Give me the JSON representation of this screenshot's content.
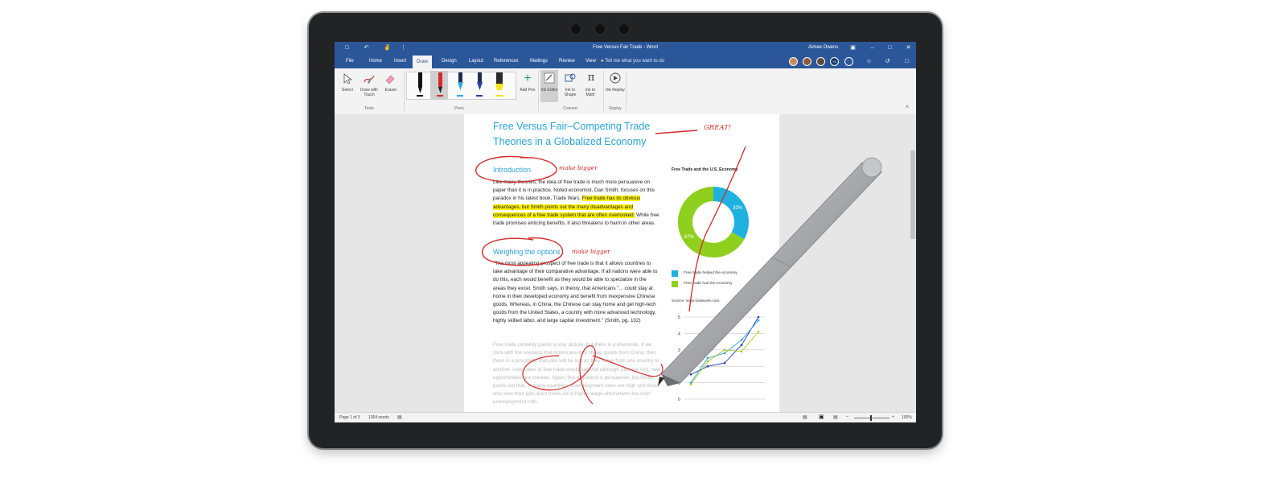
{
  "window": {
    "title": "Free Versus Fair Trade - Word",
    "user": "Aimee Owens"
  },
  "tabs": [
    "File",
    "Home",
    "Insert",
    "Draw",
    "Design",
    "Layout",
    "References",
    "Mailings",
    "Review",
    "View"
  ],
  "tell_me": "Tell me what you want to do",
  "ribbon": {
    "tools": {
      "select": "Select",
      "draw_with_touch": "Draw with Touch",
      "eraser": "Eraser",
      "group": "Tools"
    },
    "pens": {
      "group": "Pens",
      "add_pen": "Add Pen"
    },
    "convert": {
      "ink_editor": "Ink Editor",
      "ink_to_shape": "Ink to Shape",
      "ink_to_math": "Ink to Math",
      "group": "Convert"
    },
    "replay": {
      "ink_replay": "Ink Replay",
      "group": "Replay"
    }
  },
  "document": {
    "title": "Free Versus Fair–Competing Trade Theories in a Globalized Economy",
    "intro_heading": "Introduction",
    "intro_before": "Like many theories, the idea of free trade is much more persuasive on paper than it is in practice. Noted economist, Dan Smith, focuses on this paradox in his latest book, Trade Wars. ",
    "intro_highlight": "Free trade has its obvious advantages, but Smith points out the many disadvantages and consequences of a free trade system that are often overlooked.",
    "intro_after": " While free trade promises enticing benefits, it also threatens to harm in other areas.",
    "options_heading": "Weighing the options",
    "options_para": "\"The most appealing prospect of free trade is that it allows countries to take advantage of their comparative advantage. If all nations were able to do this, each would benefit as they would be able to specialize in the areas they excel. Smith says, in theory, that Americans \"... could stay at home in their developed economy and benefit from inexpensive Chinese goods. Whereas, in China, the Chinese can stay home and get high-tech goods from the United States, a country with more advanced technology, highly skilled labor, and large capital investment.\" (Smith, pg. 102)",
    "faded_para": "Free trade certainly paints a rosy picture, but there is a downside. If we stick with the scenario that Americans buy cheap goods from China, then there is a possibility that jobs will be lost as they move from one country to another. Advocates of free trade would say that although jobs are lost, new opportunities are created. Again, this argument is persuasive, but Smith points out that, in many countries, unemployment rates are high and those who lose their jobs don't move on to higher-wage alternatives but onto unemployment rolls."
  },
  "annotations": {
    "great": "GREAT!",
    "make_bigger_1": "make bigger",
    "make_bigger_2": "make bigger"
  },
  "sidebar_chart": {
    "title": "Free Trade and the U.S. Economy",
    "legend": [
      "Free trade helped the economy",
      "Free trade hurt the economy"
    ],
    "source": "Source: www.tradewire.com",
    "y_ticks": [
      "5",
      "4",
      "3",
      "2",
      "1",
      "0"
    ]
  },
  "chart_data": [
    {
      "type": "pie",
      "title": "Free Trade and the U.S. Economy",
      "labels": [
        "Free trade helped the economy",
        "Free trade hurt the economy"
      ],
      "values": [
        33,
        67
      ],
      "value_labels": [
        "33%",
        "67%"
      ],
      "colors": [
        "#1fb1e0",
        "#8fcf1e"
      ]
    },
    {
      "type": "line",
      "ylim": [
        0,
        5
      ],
      "y_ticks": [
        0,
        1,
        2,
        3,
        4,
        5
      ],
      "x": [
        1,
        2,
        3,
        4,
        5
      ],
      "series": [
        {
          "values": [
            1.5,
            2.0,
            2.2,
            3.3,
            5.0
          ],
          "color": "#1f3fae"
        },
        {
          "values": [
            1.0,
            2.5,
            2.8,
            3.6,
            4.8
          ],
          "color": "#2aa2d6"
        },
        {
          "values": [
            0.9,
            2.3,
            3.0,
            2.9,
            4.1
          ],
          "color": "#a9c81f"
        }
      ]
    }
  ],
  "status": {
    "page": "Page 1 of 3",
    "words": "1364 words",
    "zoom": "100%"
  },
  "colors": {
    "word_blue": "#2b579a",
    "heading_blue": "#2aa2d6",
    "ink_red": "#d42a2a",
    "highlight": "#fff200"
  }
}
